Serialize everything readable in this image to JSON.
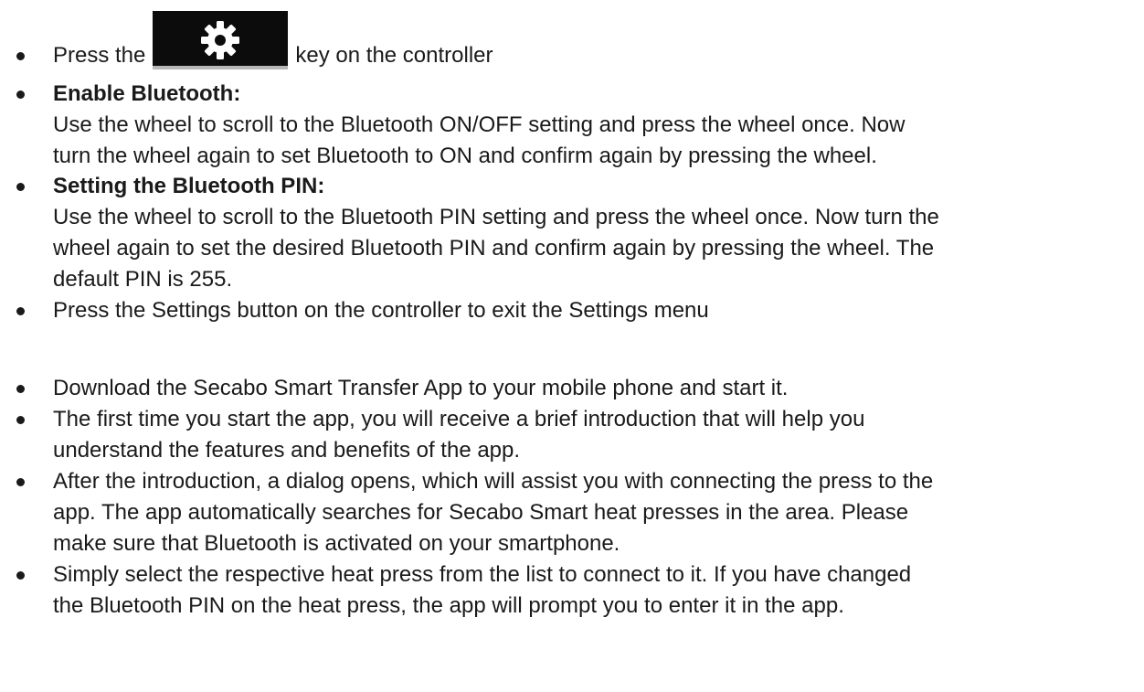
{
  "items": [
    {
      "lines": [
        "Press the",
        "key on the controller"
      ],
      "icon": "gear-icon",
      "bold": false
    },
    {
      "heading": "Enable Bluetooth:",
      "lines": [
        "Use the wheel to scroll to the Bluetooth ON/OFF setting and press the wheel once. Now",
        "turn the wheel again to set Bluetooth to ON and confirm again by pressing the wheel."
      ]
    },
    {
      "heading": "Setting the Bluetooth PIN:",
      "lines": [
        "Use the wheel to scroll to the Bluetooth PIN setting and press the wheel once. Now turn the",
        "wheel again to set the desired Bluetooth PIN and confirm again by pressing the wheel. The",
        "default PIN is 255."
      ]
    },
    {
      "lines": [
        "Press the Settings button on the controller to exit the Settings menu"
      ]
    },
    {
      "lines": [
        "Download the Secabo Smart Transfer App to your mobile phone and start it."
      ]
    },
    {
      "lines": [
        "The first time you start the app, you will receive a brief introduction that will help you",
        "understand the features and benefits of the app."
      ]
    },
    {
      "lines": [
        "After the introduction, a dialog opens, which will assist you with connecting the press to the",
        "app. The app automatically searches for Secabo Smart heat presses in the area. Please",
        "make sure that Bluetooth is activated on your smartphone."
      ]
    },
    {
      "lines": [
        "Simply select the respective heat press from the list to connect to it. If you have changed",
        "the Bluetooth PIN on the heat press, the app will prompt you to enter it in the app."
      ]
    }
  ]
}
